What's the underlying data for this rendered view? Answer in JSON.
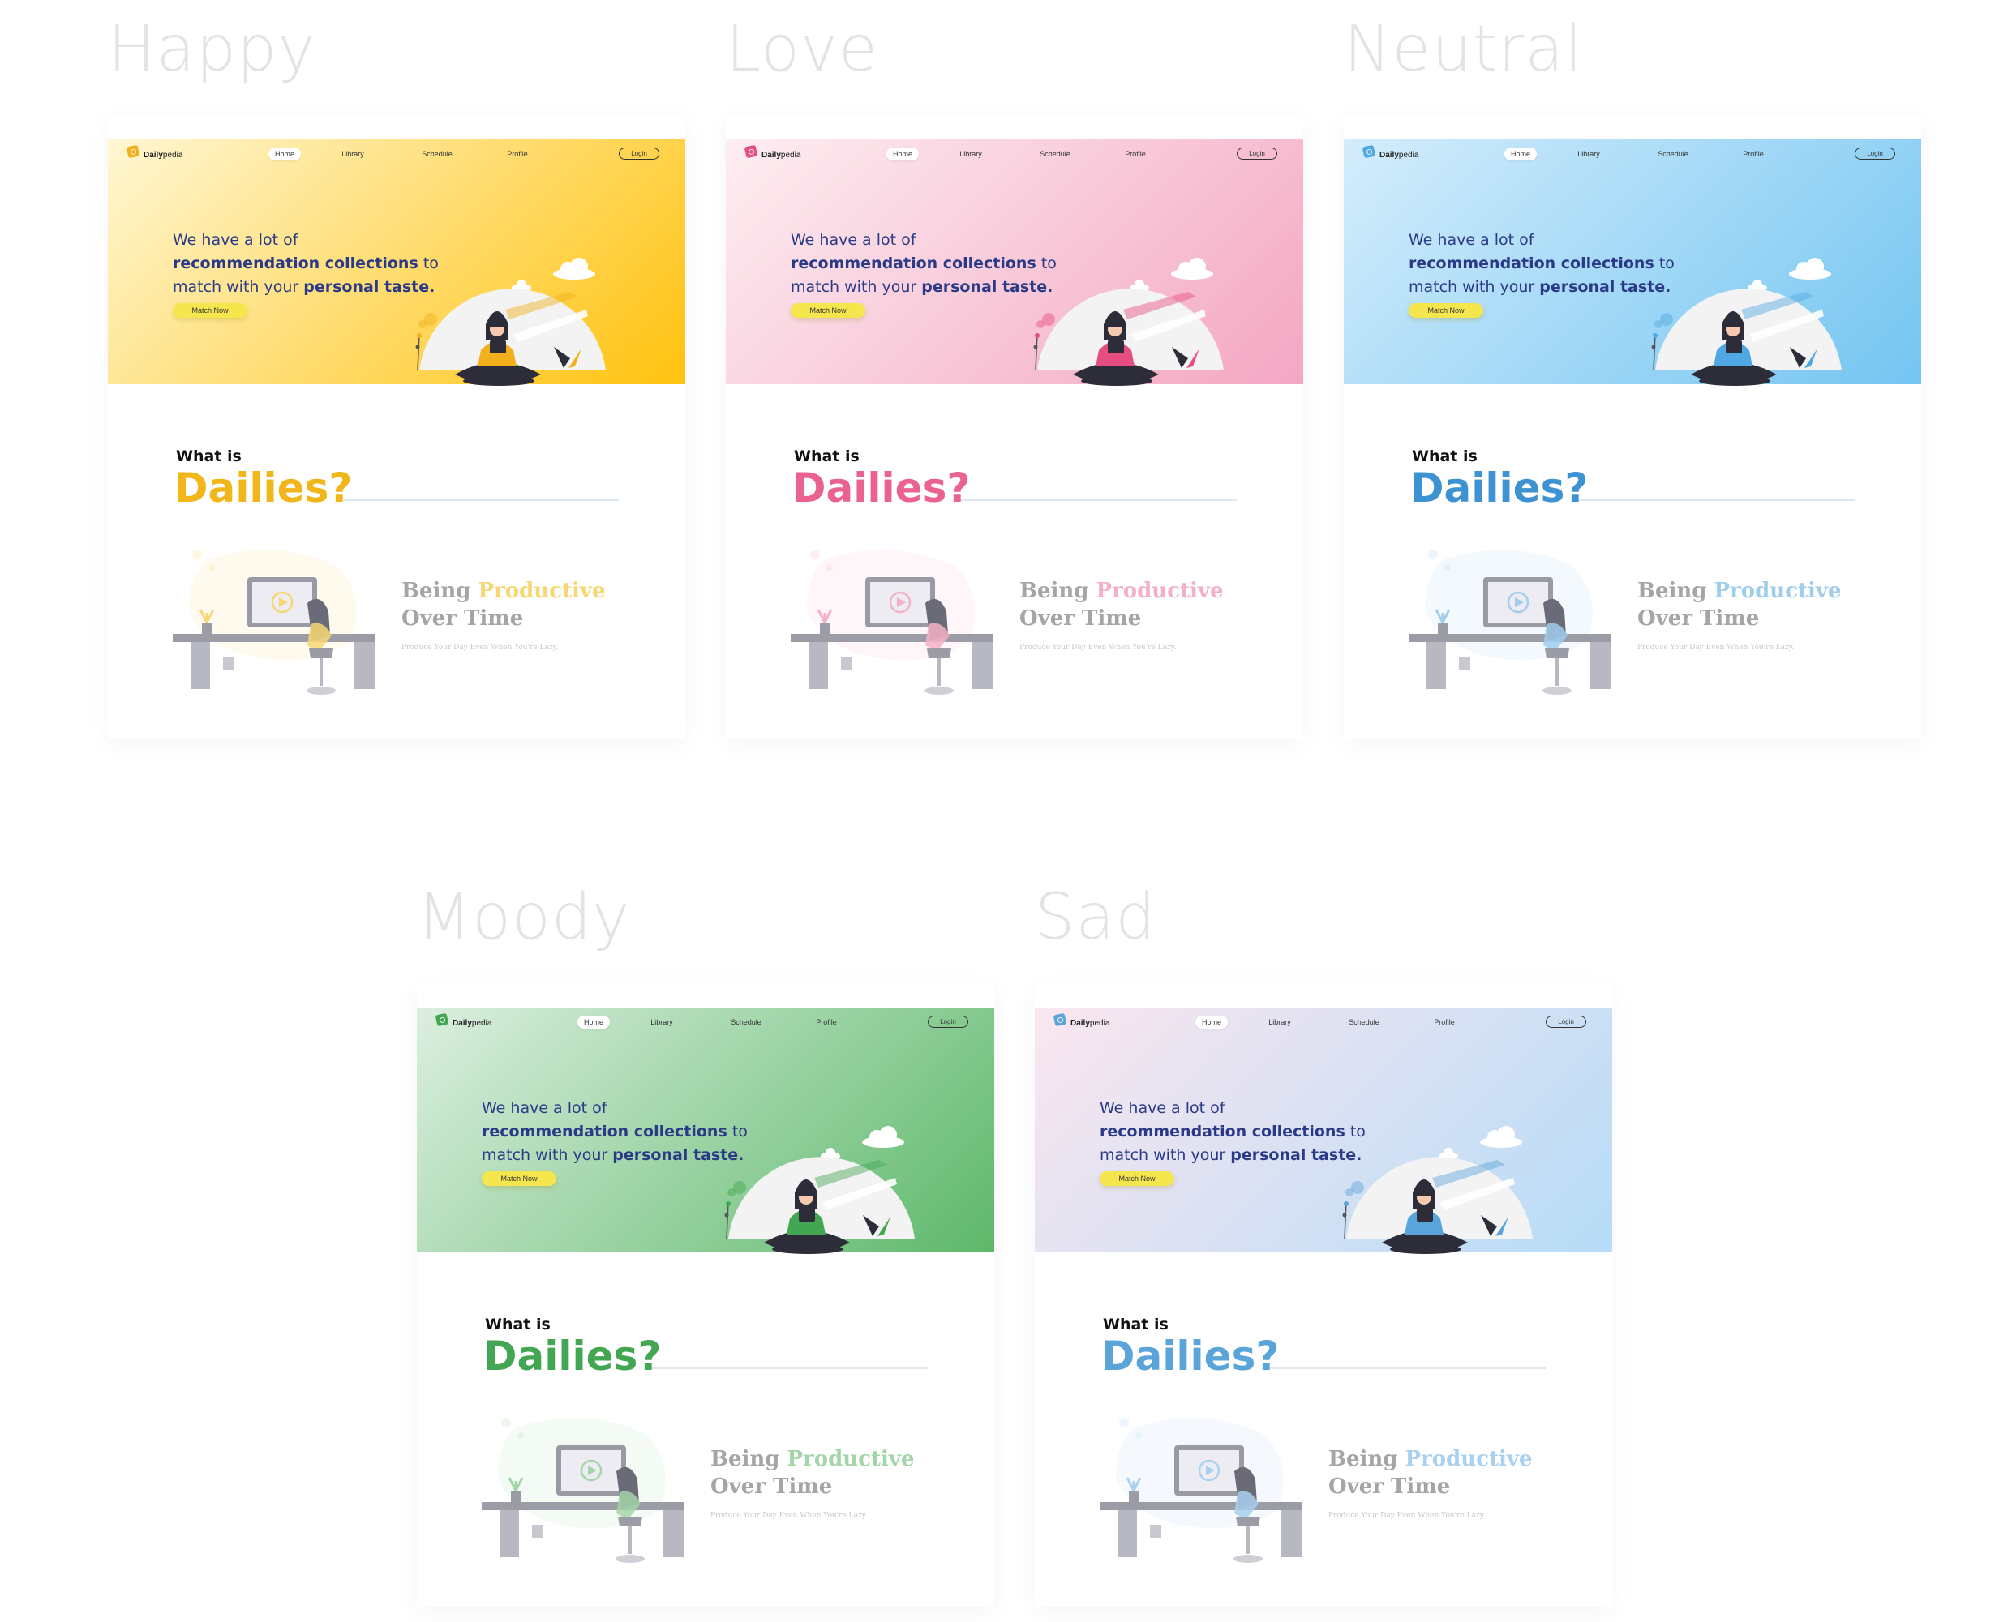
{
  "nav": {
    "logo_bold": "Daily",
    "logo_rest": "pedia",
    "home": "Home",
    "library": "Library",
    "schedule": "Schedule",
    "profile": "Profile",
    "login": "Login"
  },
  "hero": {
    "line1": "We have a lot of",
    "highlight1": "recommendation collections",
    "mid": " to",
    "line3": "match with your ",
    "highlight2": "personal taste.",
    "button": "Match Now"
  },
  "section": {
    "what_is": "What is",
    "dailies": "Dailies?"
  },
  "feature": {
    "being": "Being ",
    "productive": "Productive",
    "over_time": "Over Time",
    "subtitle": "Produce Your Day Even When You're Lazy."
  },
  "variants": [
    {
      "name": "Happy",
      "accent": "#f1b619",
      "bg_from": "#fff7d4",
      "bg_to": "#ffc20e",
      "figure": "#f2b01d",
      "feature_accent": "#f7d774"
    },
    {
      "name": "Love",
      "accent": "#ea6291",
      "bg_from": "#fdeef1",
      "bg_to": "#f4a6c2",
      "figure": "#e64d80",
      "feature_accent": "#f4b1c6"
    },
    {
      "name": "Neutral",
      "accent": "#3d93d2",
      "bg_from": "#d4edfc",
      "bg_to": "#74c5f1",
      "figure": "#4fa8e3",
      "feature_accent": "#9fcdec"
    },
    {
      "name": "Moody",
      "accent": "#43a653",
      "bg_from": "#dcefe0",
      "bg_to": "#5db86a",
      "figure": "#43a653",
      "feature_accent": "#a3d5a8"
    },
    {
      "name": "Sad",
      "accent": "#5aa4d9",
      "bg_from": "#fbe6ef",
      "bg_to": "#b6dcf7",
      "figure": "#5aa4d9",
      "feature_accent": "#a9d0ee"
    }
  ]
}
